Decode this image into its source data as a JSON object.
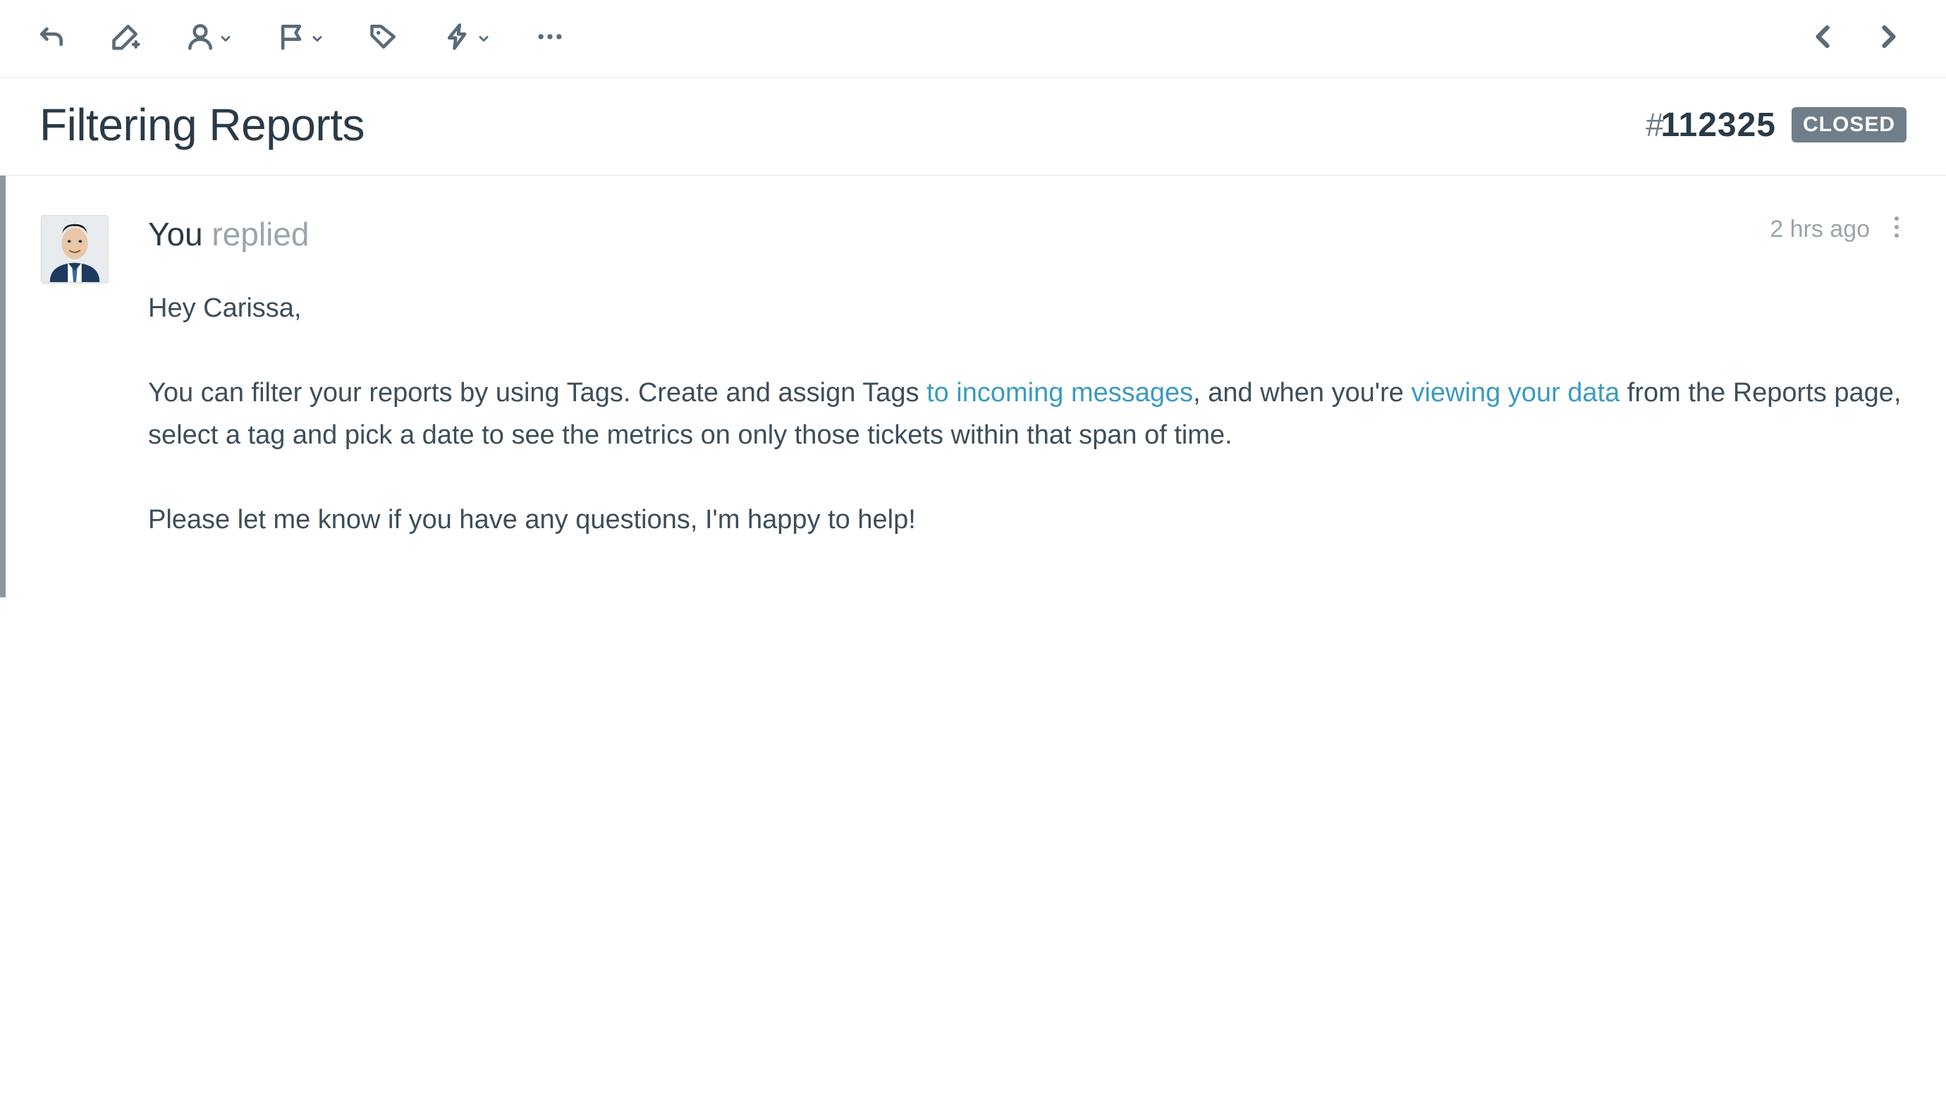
{
  "toolbar": {
    "icons": {
      "back": "back-arrow-icon",
      "compose": "pencil-plus-icon",
      "assign": "person-icon",
      "flag": "flag-icon",
      "tag": "tag-icon",
      "workflow": "lightning-icon",
      "more": "more-horizontal-icon",
      "prev": "chevron-left-icon",
      "next": "chevron-right-icon"
    }
  },
  "ticket": {
    "title": "Filtering Reports",
    "hash": "#",
    "number": "112325",
    "status": "CLOSED"
  },
  "message": {
    "author_you": "You",
    "author_action": "replied",
    "timestamp": "2 hrs ago",
    "greeting": "Hey Carissa,",
    "body_1a": "You can filter your reports by using Tags. Create and assign Tags ",
    "link_1": "to incoming messages",
    "body_1b": ", and when you're ",
    "link_2": "viewing your data",
    "body_1c": " from the Reports page, select a tag and pick a date to see the metrics on only those tickets within that span of time.",
    "closing": "Please let me know if you have any questions, I'm happy to help!"
  }
}
